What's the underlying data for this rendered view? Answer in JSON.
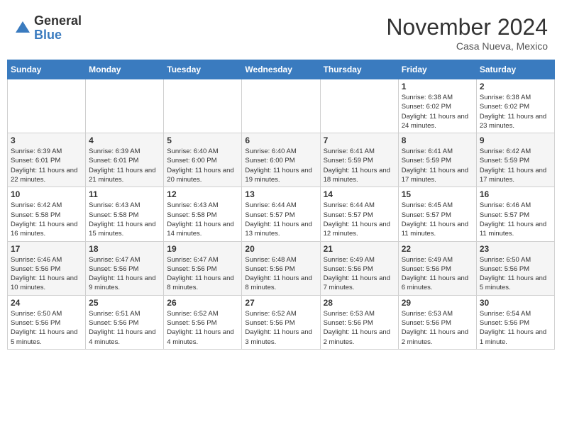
{
  "header": {
    "logo_general": "General",
    "logo_blue": "Blue",
    "month_title": "November 2024",
    "location": "Casa Nueva, Mexico"
  },
  "days_of_week": [
    "Sunday",
    "Monday",
    "Tuesday",
    "Wednesday",
    "Thursday",
    "Friday",
    "Saturday"
  ],
  "weeks": [
    [
      {
        "day": "",
        "info": ""
      },
      {
        "day": "",
        "info": ""
      },
      {
        "day": "",
        "info": ""
      },
      {
        "day": "",
        "info": ""
      },
      {
        "day": "",
        "info": ""
      },
      {
        "day": "1",
        "info": "Sunrise: 6:38 AM\nSunset: 6:02 PM\nDaylight: 11 hours and 24 minutes."
      },
      {
        "day": "2",
        "info": "Sunrise: 6:38 AM\nSunset: 6:02 PM\nDaylight: 11 hours and 23 minutes."
      }
    ],
    [
      {
        "day": "3",
        "info": "Sunrise: 6:39 AM\nSunset: 6:01 PM\nDaylight: 11 hours and 22 minutes."
      },
      {
        "day": "4",
        "info": "Sunrise: 6:39 AM\nSunset: 6:01 PM\nDaylight: 11 hours and 21 minutes."
      },
      {
        "day": "5",
        "info": "Sunrise: 6:40 AM\nSunset: 6:00 PM\nDaylight: 11 hours and 20 minutes."
      },
      {
        "day": "6",
        "info": "Sunrise: 6:40 AM\nSunset: 6:00 PM\nDaylight: 11 hours and 19 minutes."
      },
      {
        "day": "7",
        "info": "Sunrise: 6:41 AM\nSunset: 5:59 PM\nDaylight: 11 hours and 18 minutes."
      },
      {
        "day": "8",
        "info": "Sunrise: 6:41 AM\nSunset: 5:59 PM\nDaylight: 11 hours and 17 minutes."
      },
      {
        "day": "9",
        "info": "Sunrise: 6:42 AM\nSunset: 5:59 PM\nDaylight: 11 hours and 17 minutes."
      }
    ],
    [
      {
        "day": "10",
        "info": "Sunrise: 6:42 AM\nSunset: 5:58 PM\nDaylight: 11 hours and 16 minutes."
      },
      {
        "day": "11",
        "info": "Sunrise: 6:43 AM\nSunset: 5:58 PM\nDaylight: 11 hours and 15 minutes."
      },
      {
        "day": "12",
        "info": "Sunrise: 6:43 AM\nSunset: 5:58 PM\nDaylight: 11 hours and 14 minutes."
      },
      {
        "day": "13",
        "info": "Sunrise: 6:44 AM\nSunset: 5:57 PM\nDaylight: 11 hours and 13 minutes."
      },
      {
        "day": "14",
        "info": "Sunrise: 6:44 AM\nSunset: 5:57 PM\nDaylight: 11 hours and 12 minutes."
      },
      {
        "day": "15",
        "info": "Sunrise: 6:45 AM\nSunset: 5:57 PM\nDaylight: 11 hours and 11 minutes."
      },
      {
        "day": "16",
        "info": "Sunrise: 6:46 AM\nSunset: 5:57 PM\nDaylight: 11 hours and 11 minutes."
      }
    ],
    [
      {
        "day": "17",
        "info": "Sunrise: 6:46 AM\nSunset: 5:56 PM\nDaylight: 11 hours and 10 minutes."
      },
      {
        "day": "18",
        "info": "Sunrise: 6:47 AM\nSunset: 5:56 PM\nDaylight: 11 hours and 9 minutes."
      },
      {
        "day": "19",
        "info": "Sunrise: 6:47 AM\nSunset: 5:56 PM\nDaylight: 11 hours and 8 minutes."
      },
      {
        "day": "20",
        "info": "Sunrise: 6:48 AM\nSunset: 5:56 PM\nDaylight: 11 hours and 8 minutes."
      },
      {
        "day": "21",
        "info": "Sunrise: 6:49 AM\nSunset: 5:56 PM\nDaylight: 11 hours and 7 minutes."
      },
      {
        "day": "22",
        "info": "Sunrise: 6:49 AM\nSunset: 5:56 PM\nDaylight: 11 hours and 6 minutes."
      },
      {
        "day": "23",
        "info": "Sunrise: 6:50 AM\nSunset: 5:56 PM\nDaylight: 11 hours and 5 minutes."
      }
    ],
    [
      {
        "day": "24",
        "info": "Sunrise: 6:50 AM\nSunset: 5:56 PM\nDaylight: 11 hours and 5 minutes."
      },
      {
        "day": "25",
        "info": "Sunrise: 6:51 AM\nSunset: 5:56 PM\nDaylight: 11 hours and 4 minutes."
      },
      {
        "day": "26",
        "info": "Sunrise: 6:52 AM\nSunset: 5:56 PM\nDaylight: 11 hours and 4 minutes."
      },
      {
        "day": "27",
        "info": "Sunrise: 6:52 AM\nSunset: 5:56 PM\nDaylight: 11 hours and 3 minutes."
      },
      {
        "day": "28",
        "info": "Sunrise: 6:53 AM\nSunset: 5:56 PM\nDaylight: 11 hours and 2 minutes."
      },
      {
        "day": "29",
        "info": "Sunrise: 6:53 AM\nSunset: 5:56 PM\nDaylight: 11 hours and 2 minutes."
      },
      {
        "day": "30",
        "info": "Sunrise: 6:54 AM\nSunset: 5:56 PM\nDaylight: 11 hours and 1 minute."
      }
    ]
  ]
}
